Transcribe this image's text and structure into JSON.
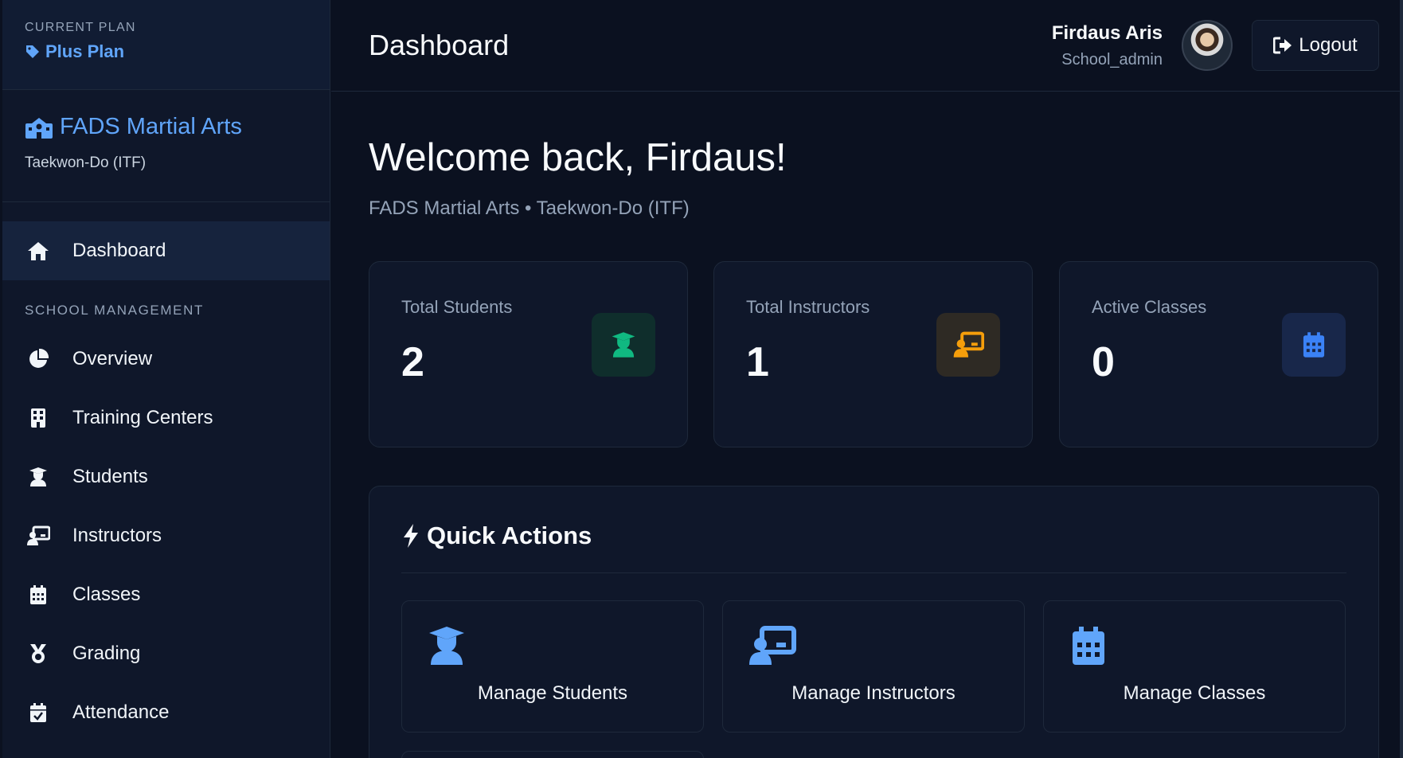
{
  "sidebar": {
    "plan_caption": "CURRENT PLAN",
    "plan_name": "Plus Plan",
    "school_name": "FADS Martial Arts",
    "school_style": "Taekwon-Do (ITF)",
    "dashboard_label": "Dashboard",
    "section_title": "SCHOOL MANAGEMENT",
    "items": [
      {
        "label": "Overview",
        "icon": "pie-chart-icon"
      },
      {
        "label": "Training Centers",
        "icon": "building-icon"
      },
      {
        "label": "Students",
        "icon": "student-icon"
      },
      {
        "label": "Instructors",
        "icon": "instructor-icon"
      },
      {
        "label": "Classes",
        "icon": "calendar-icon"
      },
      {
        "label": "Grading",
        "icon": "medal-icon"
      },
      {
        "label": "Attendance",
        "icon": "calendar-check-icon"
      }
    ]
  },
  "header": {
    "title": "Dashboard",
    "user_name": "Firdaus Aris",
    "user_role": "School_admin",
    "logout_label": "Logout"
  },
  "main": {
    "welcome": "Welcome back, Firdaus!",
    "subline": "FADS Martial Arts • Taekwon-Do (ITF)",
    "stats": [
      {
        "label": "Total Students",
        "value": "2",
        "color": "#10b981",
        "bg": "#0f2e2c"
      },
      {
        "label": "Total Instructors",
        "value": "1",
        "color": "#f59e0b",
        "bg": "#2e2a24"
      },
      {
        "label": "Active Classes",
        "value": "0",
        "color": "#3b82f6",
        "bg": "#18274a"
      }
    ],
    "quick_actions": {
      "title": "Quick Actions",
      "items": [
        {
          "label": "Manage Students",
          "icon": "student-icon"
        },
        {
          "label": "Manage Instructors",
          "icon": "instructor-icon"
        },
        {
          "label": "Manage Classes",
          "icon": "calendar-icon"
        }
      ]
    }
  },
  "colors": {
    "accent": "#60a5fa",
    "background": "#0b1120",
    "panel": "#0f172a"
  }
}
